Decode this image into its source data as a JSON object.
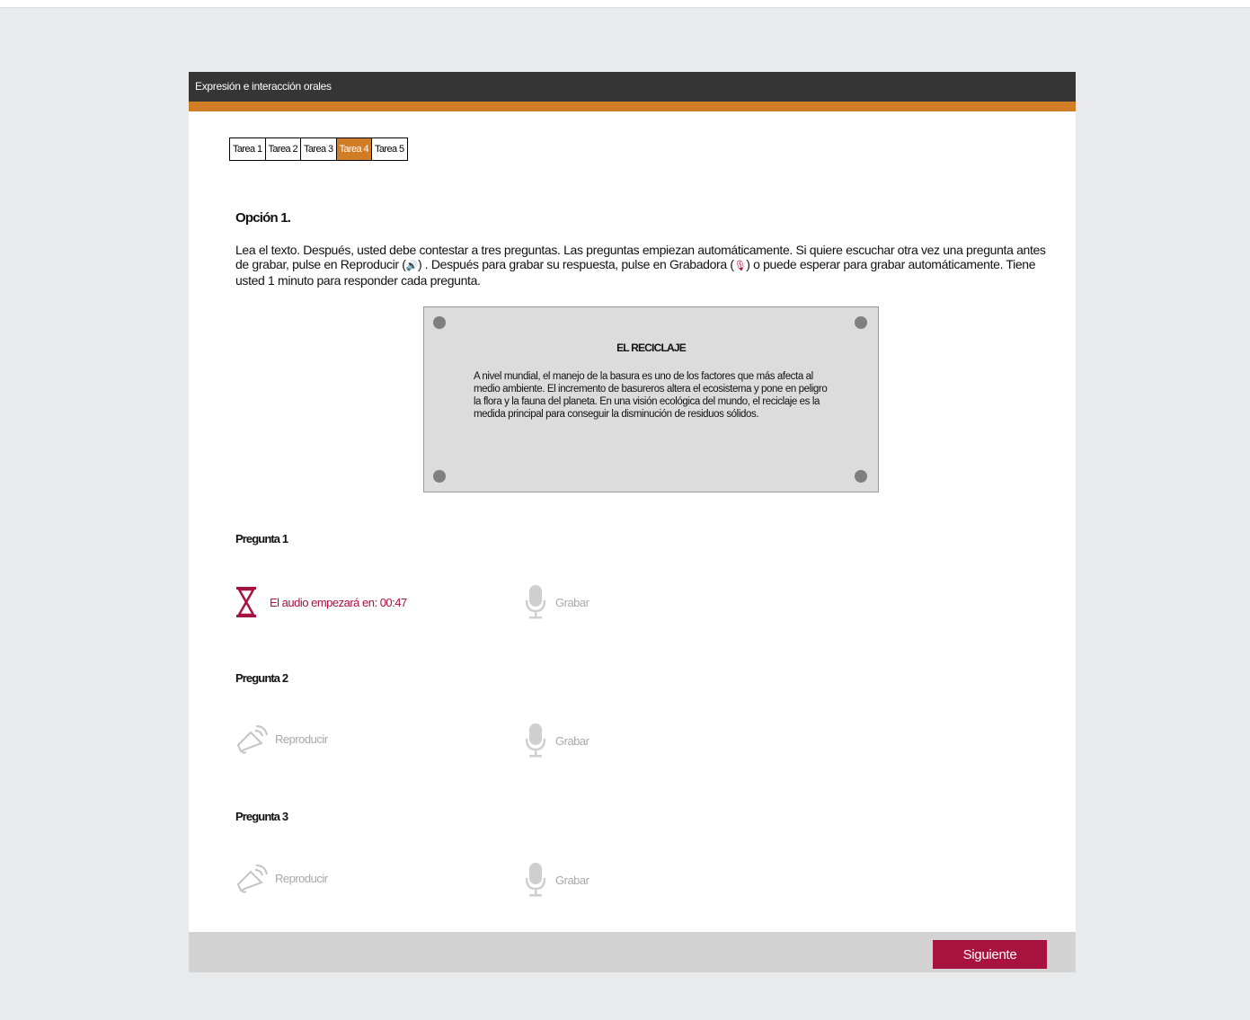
{
  "header": {
    "title": "Expresión e interacción orales"
  },
  "tabs": [
    {
      "label": "Tarea 1",
      "active": false
    },
    {
      "label": "Tarea 2",
      "active": false
    },
    {
      "label": "Tarea 3",
      "active": false
    },
    {
      "label": "Tarea 4",
      "active": true
    },
    {
      "label": "Tarea 5",
      "active": false
    }
  ],
  "option": {
    "title": "Opción 1.",
    "instructions": {
      "part1": "Lea el texto. Después, usted debe contestar a tres preguntas. Las preguntas empiezan automáticamente. Si quiere escuchar otra vez una pregunta antes de grabar, pulse en Reproducir (",
      "part2": ") . Después para grabar su respuesta, pulse en Grabadora (",
      "part3": ") o puede esperar para grabar automáticamente. Tiene usted 1 minuto para responder cada pregunta.",
      "play_icon": "speaker-icon",
      "record_icon": "microphone-icon"
    }
  },
  "reading": {
    "title": "EL RECICLAJE",
    "text": "A nivel mundial, el manejo de la basura es uno de los factores que más afecta al medio ambiente. El incremento de basureros altera el ecosistema y pone en peligro la flora y la fauna del planeta. En una visión ecológica del mundo, el reciclaje es la medida principal para conseguir la disminución de residuos sólidos."
  },
  "questions": [
    {
      "title": "Pregunta 1",
      "countdown_label": "El audio empezará en: 00:47",
      "record_label": "Grabar"
    },
    {
      "title": "Pregunta 2",
      "play_label": "Reproducir",
      "record_label": "Grabar"
    },
    {
      "title": "Pregunta 3",
      "play_label": "Reproducir",
      "record_label": "Grabar"
    }
  ],
  "footer": {
    "next_label": "Siguiente"
  },
  "colors": {
    "accent": "#d17d25",
    "brand": "#a8123e",
    "header_bg": "#353535",
    "disabled": "#a9a9a9"
  }
}
